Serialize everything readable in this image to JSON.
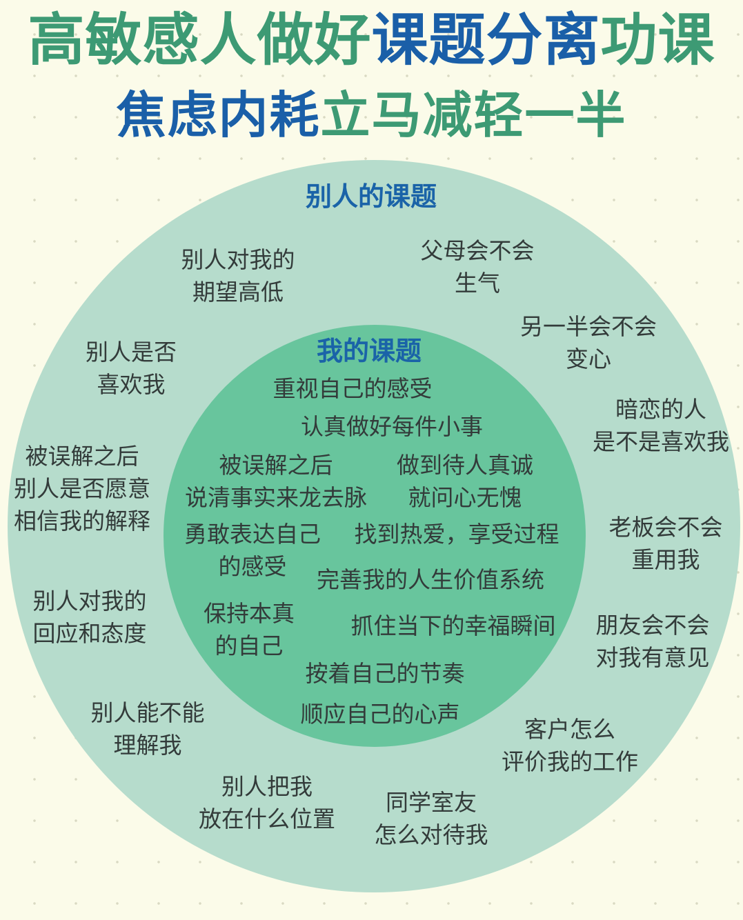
{
  "title": {
    "segments": [
      {
        "text": "高敏感人做好",
        "color": "#3d9a74"
      },
      {
        "text": "课题分离",
        "color": "#1a5fa8"
      },
      {
        "text": "功课",
        "color": "#3d9a74"
      }
    ]
  },
  "subtitle": {
    "segments": [
      {
        "text": "焦虑内耗",
        "color": "#1a5fa8"
      },
      {
        "text": "立马减轻一半",
        "color": "#3d9a74"
      }
    ]
  },
  "outer": {
    "heading": "别人的课题",
    "items": [
      "别人对我的\n期望高低",
      "父母会不会\n生气",
      "另一半会不会\n变心",
      "别人是否\n喜欢我",
      "暗恋的人\n是不是喜欢我",
      "被误解之后\n别人是否愿意\n相信我的解释",
      "老板会不会\n重用我",
      "别人对我的\n回应和态度",
      "朋友会不会\n对我有意见",
      "别人能不能\n理解我",
      "客户怎么\n评价我的工作",
      "别人把我\n放在什么位置",
      "同学室友\n怎么对待我"
    ]
  },
  "inner": {
    "heading": "我的课题",
    "items": [
      "重视自己的感受",
      "认真做好每件小事",
      "被误解之后\n说清事实来龙去脉",
      "做到待人真诚\n就问心无愧",
      "勇敢表达自己\n的感受",
      "找到热爱，享受过程",
      "完善我的人生价值系统",
      "保持本真\n的自己",
      "抓住当下的幸福瞬间",
      "按着自己的节奏",
      "顺应自己的心声"
    ]
  },
  "colors": {
    "background": "#fbfbe9",
    "outer_circle": "#b6dccc",
    "inner_circle": "#68c59d",
    "heading_blue": "#1a63a8",
    "title_green": "#3d9a74",
    "text": "#333b3a"
  }
}
